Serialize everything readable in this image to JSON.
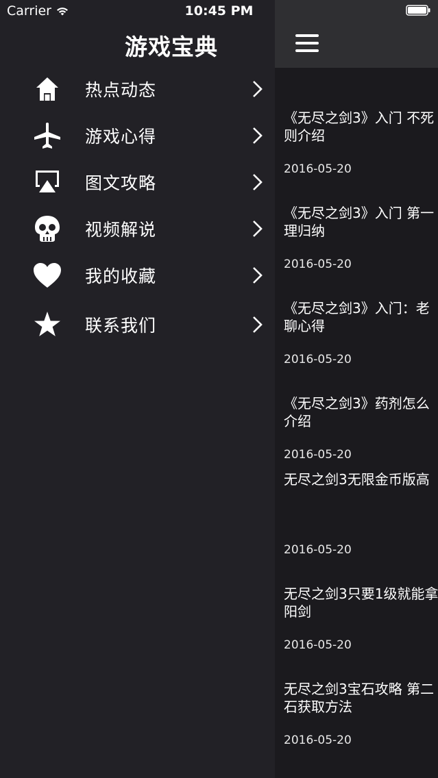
{
  "status_bar": {
    "carrier": "Carrier",
    "time": "10:45 PM"
  },
  "drawer": {
    "title": "游戏宝典",
    "items": [
      {
        "label": "热点动态",
        "icon": "home-icon"
      },
      {
        "label": "游戏心得",
        "icon": "airplane-icon"
      },
      {
        "label": "图文攻略",
        "icon": "airplay-icon"
      },
      {
        "label": "视频解说",
        "icon": "skull-icon"
      },
      {
        "label": "我的收藏",
        "icon": "heart-icon"
      },
      {
        "label": "联系我们",
        "icon": "star-icon"
      }
    ]
  },
  "content": {
    "menu_icon": "hamburger-menu-icon",
    "articles": [
      {
        "title_line1": "《无尽之剑3》入门 不死",
        "title_line2": "则介绍",
        "date": "2016-05-20"
      },
      {
        "title_line1": "《无尽之剑3》入门 第一",
        "title_line2": "理归纳",
        "date": "2016-05-20"
      },
      {
        "title_line1": "《无尽之剑3》入门：老",
        "title_line2": "聊心得",
        "date": "2016-05-20"
      },
      {
        "title_line1": "《无尽之剑3》药剂怎么",
        "title_line2": "介绍",
        "date": "2016-05-20"
      },
      {
        "title_line1": "无尽之剑3无限金币版高",
        "title_line2": "",
        "date": "2016-05-20"
      },
      {
        "title_line1": "无尽之剑3只要1级就能拿",
        "title_line2": "阳剑",
        "date": "2016-05-20"
      },
      {
        "title_line1": "无尽之剑3宝石攻略 第二",
        "title_line2": "石获取方法",
        "date": "2016-05-20"
      }
    ]
  },
  "colors": {
    "drawer_bg": "#222126",
    "content_bg": "#1b1a1e",
    "navbar_bg": "#2f2f32",
    "text": "#ffffff"
  }
}
